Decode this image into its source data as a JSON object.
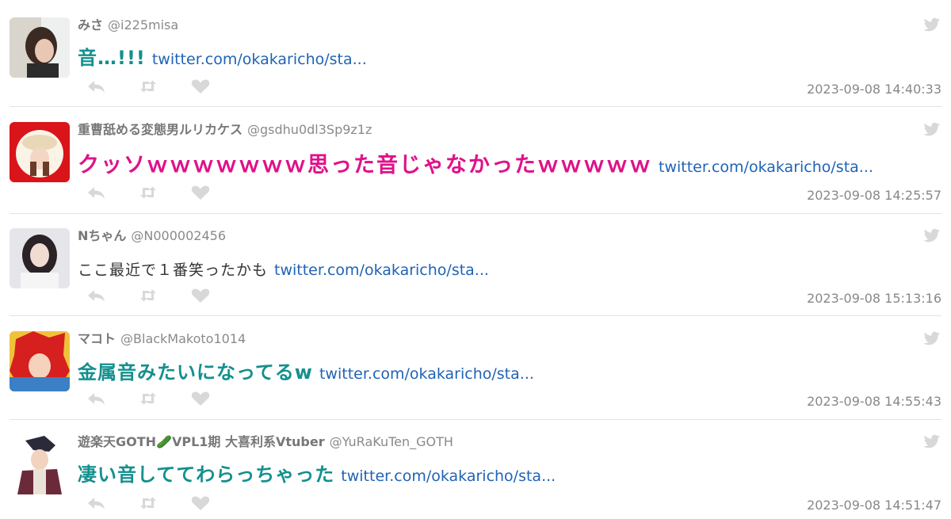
{
  "tweets": [
    {
      "name": "みさ",
      "handle": "@i225misa",
      "text": "音…!!!",
      "link": "twitter.com/okakaricho/sta...",
      "time": "2023-09-08 14:40:33"
    },
    {
      "name": "重曹舐める変態男ルリカケス",
      "handle": "@gsdhu0dl3Sp9z1z",
      "text": "クッソｗｗｗｗｗｗｗ思った音じゃなかったｗｗｗｗｗ",
      "link": "twitter.com/okakaricho/sta...",
      "time": "2023-09-08 14:25:57"
    },
    {
      "name": "Nちゃん",
      "handle": "@N000002456",
      "text": "ここ最近で１番笑ったかも",
      "link": "twitter.com/okakaricho/sta...",
      "time": "2023-09-08 15:13:16"
    },
    {
      "name": "マコト",
      "handle": "@BlackMakoto1014",
      "text": "金属音みたいになってるw",
      "link": "twitter.com/okakaricho/sta...",
      "time": "2023-09-08 14:55:43"
    },
    {
      "name": "遊楽天GOTH🥒VPL1期 大喜利系Vtuber",
      "handle": "@YuRaKuTen_GOTH",
      "text": "凄い音しててわらっちゃった",
      "link": "twitter.com/okakaricho/sta...",
      "time": "2023-09-08 14:51:47"
    }
  ],
  "colors": {
    "teal": "#13908e",
    "pink": "#e0118a",
    "link": "#1f63b5",
    "meta": "#888888",
    "icon": "#d8d8d8"
  },
  "icons": {
    "reply": "reply-icon",
    "retweet": "retweet-icon",
    "like": "heart-icon",
    "source": "twitter-bird-icon"
  }
}
